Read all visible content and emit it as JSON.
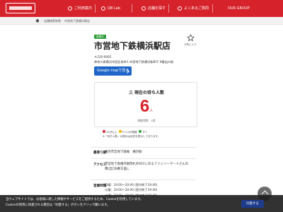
{
  "header": {
    "logo_name": "logo",
    "nav": [
      {
        "label": "ご利用案内",
        "icon": "info-icon"
      },
      {
        "label": "QB Lab",
        "icon": "lab-icon"
      },
      {
        "label": "店舗を探す",
        "icon": "search-icon"
      },
      {
        "label": "よくあるご質問",
        "icon": "question-icon"
      },
      {
        "label": "OUR GROUP",
        "icon": ""
      }
    ]
  },
  "breadcrumb": {
    "home_icon": "home-icon",
    "items": [
      "店舗検索結果",
      "市営地下鉄横浜駅店"
    ]
  },
  "store": {
    "badge": "営業中",
    "name": "市営地下鉄横浜駅店",
    "favorite_label": "お気に入り",
    "zip": "〒220-0005",
    "address": "神奈川県横浜市西区南幸1 市営地下鉄横浜駅B1F 8番出口前",
    "map_button": "Google mapで見る"
  },
  "wait": {
    "heading": "現在の待ち人数",
    "count": "6",
    "unit": "人",
    "staff": "稼働席数：4席"
  },
  "legend": {
    "items": [
      {
        "label": "15分以上",
        "color": "#d6222a"
      },
      {
        "label": "5〜14分程度",
        "color": "#f0b400"
      },
      {
        "label": "すぐ",
        "color": "#2e9d3a"
      }
    ],
    "note": "※「待ち人数」の表示は目安を表示しております。"
  },
  "info": {
    "rows": [
      {
        "key": "最寄り駅",
        "value": "横浜市営地下鉄線　横浜駅"
      },
      {
        "key": "アクセス",
        "value": "市営地下鉄横浜駅改札外B1Fにあるファミリーマートさんの隣(出口8番方面)。"
      },
      {
        "key": "営業時間",
        "value": ""
      }
    ],
    "hours": [
      "月曜：10:00〜20:00 (受付終了19:40)",
      "火曜：10:00〜20:00 (受付終了19:40)",
      "水曜：10:00〜20:00 (受付終了19:40)"
    ]
  },
  "cookie": {
    "line1": "当ウェブサイトでは、お客様に適した情報やサービスをご提供するため、Cookieを利用しています。",
    "line2": "Cookieの利用に同意される場合は「同意する」ボタンをクリック願います。",
    "button": "同意する"
  }
}
